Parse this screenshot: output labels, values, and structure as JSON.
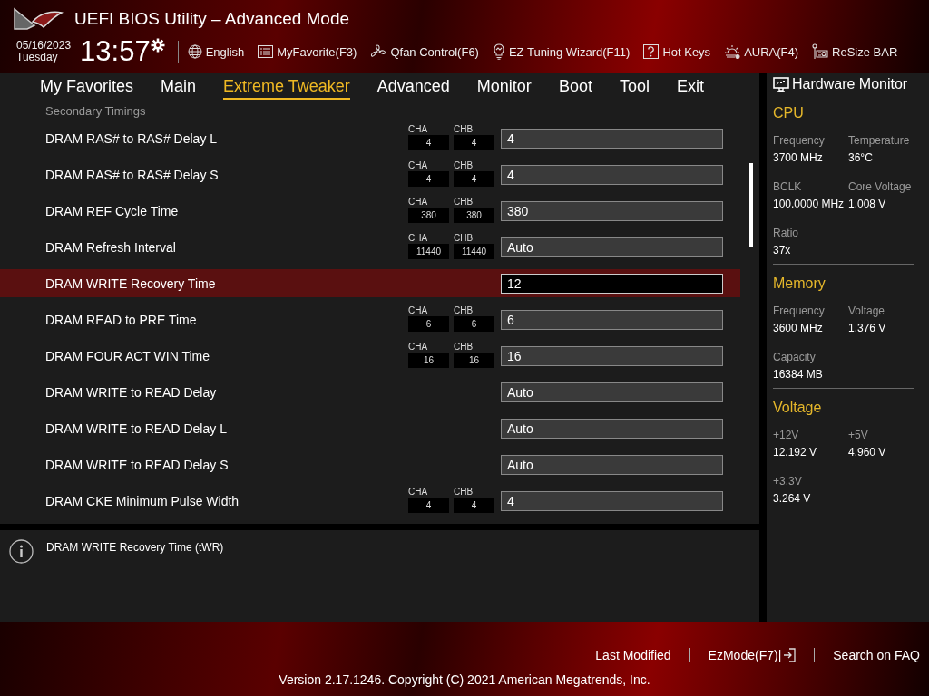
{
  "header": {
    "title": "UEFI BIOS Utility – Advanced Mode",
    "date": "05/16/2023",
    "day": "Tuesday",
    "time": "13:57",
    "toolbar": [
      {
        "label": "English",
        "kind": "globe"
      },
      {
        "label": "MyFavorite(F3)",
        "kind": "list"
      },
      {
        "label": "Qfan Control(F6)",
        "kind": "fan"
      },
      {
        "label": "EZ Tuning Wizard(F11)",
        "kind": "bulb"
      },
      {
        "label": "Hot Keys",
        "kind": "question"
      },
      {
        "label": "AURA(F4)",
        "kind": "aura"
      },
      {
        "label": "ReSize BAR",
        "kind": "card"
      }
    ]
  },
  "tabs": [
    {
      "label": "My Favorites",
      "selected": false
    },
    {
      "label": "Main",
      "selected": false
    },
    {
      "label": "Extreme Tweaker",
      "selected": true
    },
    {
      "label": "Advanced",
      "selected": false
    },
    {
      "label": "Monitor",
      "selected": false
    },
    {
      "label": "Boot",
      "selected": false
    },
    {
      "label": "Tool",
      "selected": false
    },
    {
      "label": "Exit",
      "selected": false
    }
  ],
  "section_title": "Secondary Timings",
  "settings": [
    {
      "label": "DRAM RAS# to RAS# Delay L",
      "cha_label": "CHA",
      "cha": "4",
      "chb_label": "CHB",
      "chb": "4",
      "value": "4",
      "selected": false
    },
    {
      "label": "DRAM RAS# to RAS# Delay S",
      "cha_label": "CHA",
      "cha": "4",
      "chb_label": "CHB",
      "chb": "4",
      "value": "4",
      "selected": false
    },
    {
      "label": "DRAM REF Cycle Time",
      "cha_label": "CHA",
      "cha": "380",
      "chb_label": "CHB",
      "chb": "380",
      "value": "380",
      "selected": false
    },
    {
      "label": "DRAM Refresh Interval",
      "cha_label": "CHA",
      "cha": "11440",
      "chb_label": "CHB",
      "chb": "11440",
      "value": "Auto",
      "selected": false
    },
    {
      "label": "DRAM WRITE Recovery Time",
      "value": "12",
      "selected": true
    },
    {
      "label": "DRAM READ to PRE Time",
      "cha_label": "CHA",
      "cha": "6",
      "chb_label": "CHB",
      "chb": "6",
      "value": "6",
      "selected": false
    },
    {
      "label": "DRAM FOUR ACT WIN Time",
      "cha_label": "CHA",
      "cha": "16",
      "chb_label": "CHB",
      "chb": "16",
      "value": "16",
      "selected": false
    },
    {
      "label": "DRAM WRITE to READ Delay",
      "value": "Auto",
      "selected": false
    },
    {
      "label": "DRAM WRITE to READ Delay L",
      "value": "Auto",
      "selected": false
    },
    {
      "label": "DRAM WRITE to READ Delay S",
      "value": "Auto",
      "selected": false
    },
    {
      "label": "DRAM CKE Minimum Pulse Width",
      "cha_label": "CHA",
      "cha": "4",
      "chb_label": "CHB",
      "chb": "4",
      "value": "4",
      "selected": false
    }
  ],
  "help_text": "DRAM WRITE Recovery Time (tWR)",
  "hardware_monitor": {
    "title": "Hardware Monitor",
    "groups": [
      {
        "title": "CPU",
        "items": [
          {
            "label": "Frequency",
            "value": "3700 MHz"
          },
          {
            "label": "Temperature",
            "value": "36°C"
          },
          {
            "label": "BCLK",
            "value": "100.0000 MHz"
          },
          {
            "label": "Core Voltage",
            "value": "1.008 V"
          },
          {
            "label": "Ratio",
            "value": "37x"
          }
        ]
      },
      {
        "title": "Memory",
        "items": [
          {
            "label": "Frequency",
            "value": "3600 MHz"
          },
          {
            "label": "Voltage",
            "value": "1.376 V"
          },
          {
            "label": "Capacity",
            "value": "16384 MB"
          }
        ]
      },
      {
        "title": "Voltage",
        "items": [
          {
            "label": "+12V",
            "value": "12.192 V"
          },
          {
            "label": "+5V",
            "value": "4.960 V"
          },
          {
            "label": "+3.3V",
            "value": "3.264 V"
          }
        ]
      }
    ]
  },
  "footer": {
    "links": [
      "Last Modified",
      "EzMode(F7)|",
      "Search on FAQ"
    ],
    "version": "Version 2.17.1246. Copyright (C) 2021 American Megatrends, Inc."
  }
}
